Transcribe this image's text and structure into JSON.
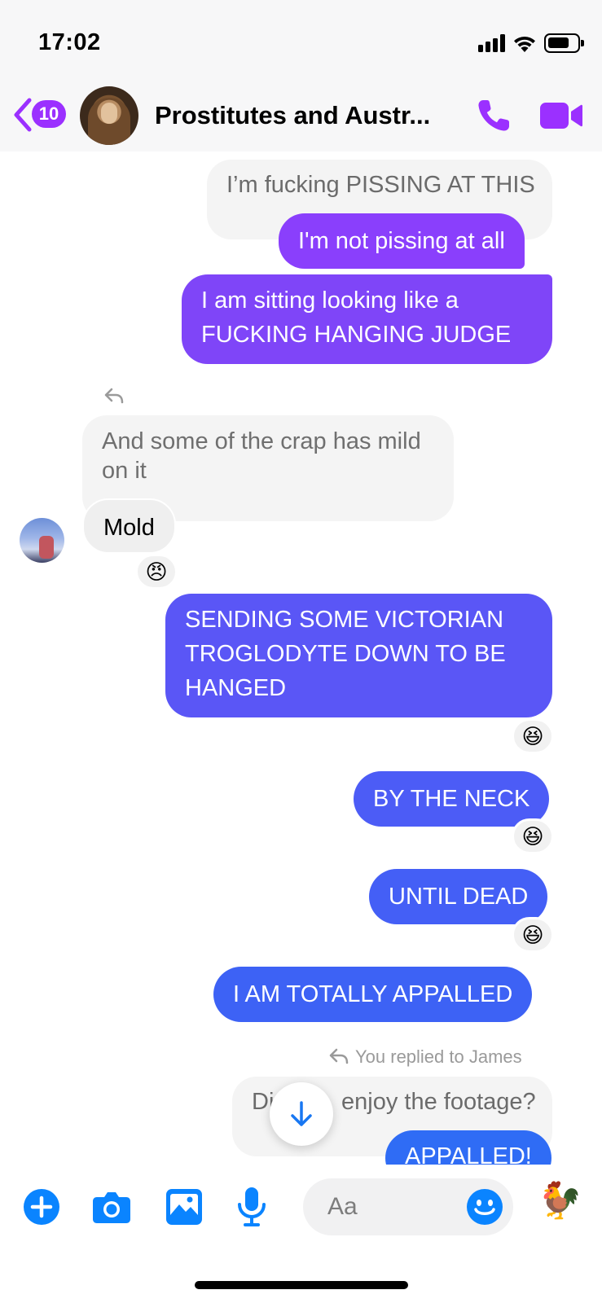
{
  "status_bar": {
    "time": "17:02"
  },
  "header": {
    "unread_count": "10",
    "title": "Prostitutes and Austr..."
  },
  "messages": [
    {
      "id": "m1",
      "direction": "outgoing",
      "text": "I’m fucking PISSING AT THIS",
      "style": "quoted"
    },
    {
      "id": "m2",
      "direction": "outgoing",
      "text": "I'm not pissing at all"
    },
    {
      "id": "m3",
      "direction": "outgoing",
      "lines": [
        "I am sitting looking like a",
        "FUCKING HANGING JUDGE"
      ]
    },
    {
      "id": "m4",
      "direction": "incoming",
      "lines": [
        "And some of the crap has mild",
        "on it"
      ],
      "style": "quoted"
    },
    {
      "id": "m5",
      "direction": "incoming",
      "text": "Mold",
      "reaction": "😠"
    },
    {
      "id": "m6",
      "direction": "outgoing",
      "lines": [
        "SENDING SOME VICTORIAN",
        "TROGLODYTE DOWN TO BE",
        "HANGED"
      ],
      "reaction": "😆"
    },
    {
      "id": "m7",
      "direction": "outgoing",
      "text": "BY THE NECK",
      "reaction": "😆"
    },
    {
      "id": "m8",
      "direction": "outgoing",
      "text": "UNTIL DEAD",
      "reaction": "😆"
    },
    {
      "id": "m9",
      "direction": "outgoing",
      "text": "I AM TOTALLY APPALLED"
    },
    {
      "id": "m10",
      "direction": "outgoing",
      "reply_meta": "You replied to James",
      "quoted_parts": [
        "Di",
        "enjoy the footage?"
      ],
      "style": "quoted"
    },
    {
      "id": "m11",
      "direction": "outgoing",
      "text": "APPALLED!"
    }
  ],
  "composer": {
    "placeholder": "Aa",
    "like_emoji": "🐓"
  },
  "colors": {
    "purple": "#9b30ff",
    "violet": "#7d4cf5",
    "indigo": "#5458f6",
    "blue": "#3a63f5",
    "icon_blue": "#0a84ff"
  }
}
